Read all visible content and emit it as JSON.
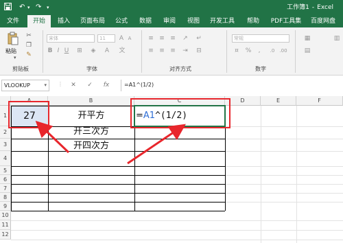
{
  "titlebar": {
    "doc_title": "工作簿1",
    "separator": "-",
    "app_name": "Excel",
    "undo_symbol": "↶",
    "redo_symbol": "↷",
    "save_icon": "save-icon"
  },
  "tabs": [
    {
      "label": "文件",
      "active": false
    },
    {
      "label": "开始",
      "active": true
    },
    {
      "label": "插入",
      "active": false
    },
    {
      "label": "页面布局",
      "active": false
    },
    {
      "label": "公式",
      "active": false
    },
    {
      "label": "数据",
      "active": false
    },
    {
      "label": "审阅",
      "active": false
    },
    {
      "label": "视图",
      "active": false
    },
    {
      "label": "开发工具",
      "active": false
    },
    {
      "label": "帮助",
      "active": false
    },
    {
      "label": "PDF工具集",
      "active": false
    },
    {
      "label": "百度网盘",
      "active": false
    }
  ],
  "ribbon": {
    "paste_label": "粘贴",
    "font_name": "宋体",
    "font_size": "11",
    "number_format": "常规",
    "groups": {
      "clipboard": "剪贴板",
      "font": "字体",
      "alignment": "对齐方式",
      "number": "数字"
    }
  },
  "formula_bar": {
    "name_box": "VLOOKUP",
    "cancel_symbol": "✕",
    "enter_symbol": "✓",
    "fx_label": "fx",
    "formula": "=A1^(1/2)"
  },
  "columns": [
    "A",
    "B",
    "C",
    "D",
    "E",
    "F"
  ],
  "rows": [
    "1",
    "2",
    "3",
    "4",
    "5",
    "6",
    "7",
    "8",
    "9",
    "10",
    "11",
    "12"
  ],
  "cells": {
    "A1": "27",
    "B1": "开平方",
    "B2": "开三次方",
    "B3": "开四次方",
    "C1_ref": "A1",
    "C1_prefix": "=",
    "C1_suffix": "^(1/2)"
  },
  "colors": {
    "excel_green": "#217346",
    "highlight_red": "#e8262c",
    "selected_cell": "#dce6f4",
    "formula_ref_blue": "#2f6fd6"
  }
}
